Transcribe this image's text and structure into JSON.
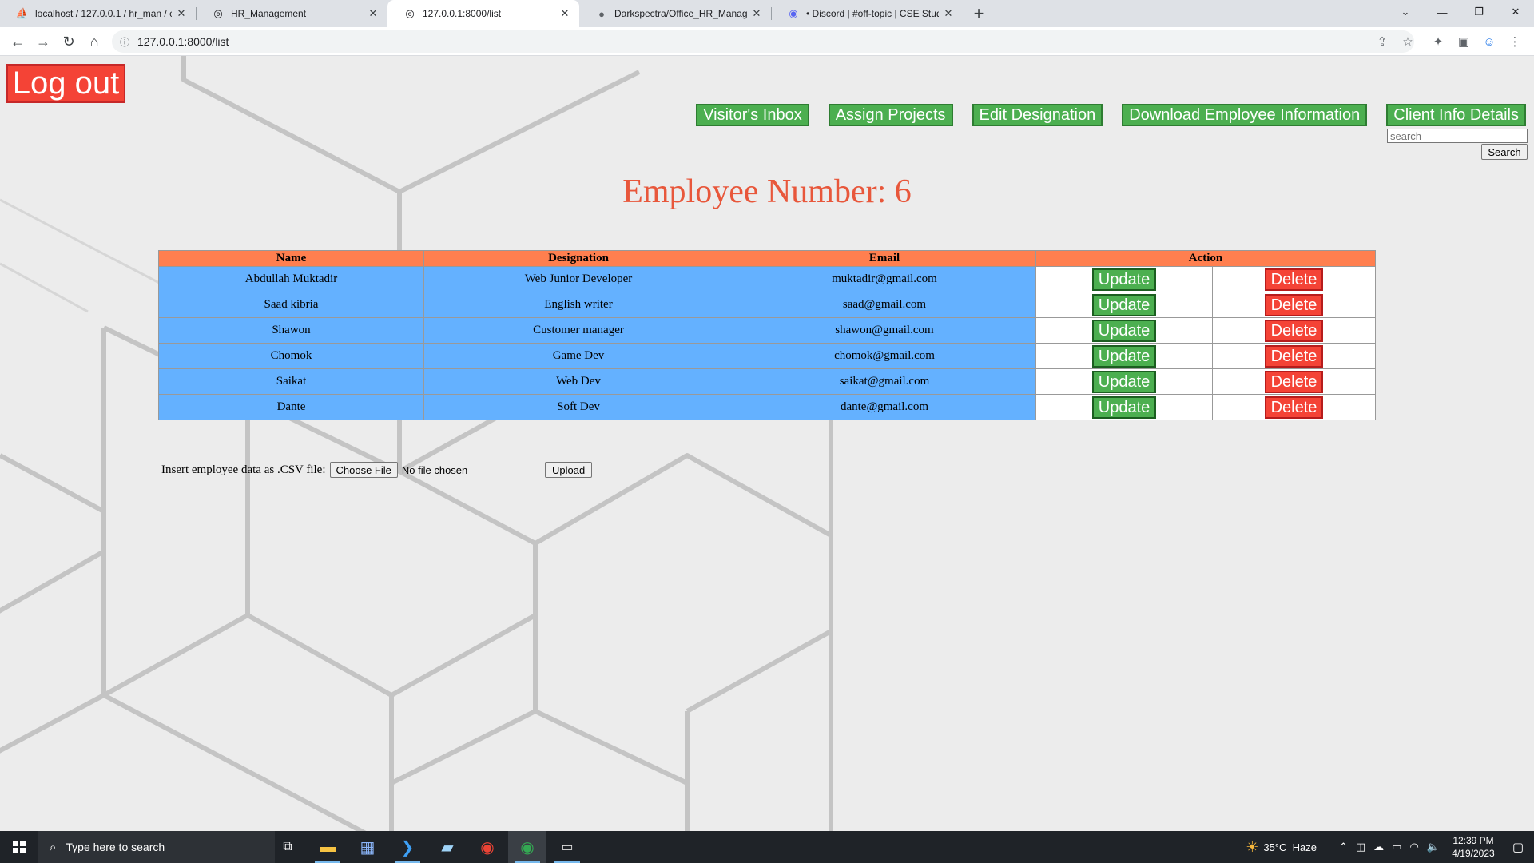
{
  "browser": {
    "tabs": [
      {
        "title": "localhost / 127.0.0.1 / hr_man / e",
        "active": false
      },
      {
        "title": "HR_Management",
        "active": false
      },
      {
        "title": "127.0.0.1:8000/list",
        "active": true
      },
      {
        "title": "Darkspectra/Office_HR_Managem",
        "active": false
      },
      {
        "title": "• Discord | #off-topic | CSE Stude",
        "active": false
      }
    ],
    "url": "127.0.0.1:8000/list"
  },
  "page": {
    "logout_label": "Log out",
    "nav": [
      "Visitor's Inbox",
      "Assign Projects",
      "Edit Designation",
      "Download Employee Information",
      "Client Info Details"
    ],
    "search_placeholder": "search",
    "search_button": "Search",
    "heading": "Employee Number: 6",
    "table": {
      "headers": [
        "Name",
        "Designation",
        "Email",
        "Action"
      ],
      "rows": [
        {
          "name": "Abdullah Muktadir",
          "designation": "Web Junior Developer",
          "email": "muktadir@gmail.com"
        },
        {
          "name": "Saad kibria",
          "designation": "English writer",
          "email": "saad@gmail.com"
        },
        {
          "name": "Shawon",
          "designation": "Customer manager",
          "email": "shawon@gmail.com"
        },
        {
          "name": "Chomok",
          "designation": "Game Dev",
          "email": "chomok@gmail.com"
        },
        {
          "name": "Saikat",
          "designation": "Web Dev",
          "email": "saikat@gmail.com"
        },
        {
          "name": "Dante",
          "designation": "Soft Dev",
          "email": "dante@gmail.com"
        }
      ],
      "update_label": "Update",
      "delete_label": "Delete"
    },
    "csv": {
      "label": "Insert employee data as .CSV file:",
      "choose_label": "Choose File",
      "no_file": "No file chosen",
      "upload_label": "Upload"
    }
  },
  "taskbar": {
    "search_placeholder": "Type here to search",
    "weather": "35°C  Haze",
    "time": "12:39 PM",
    "date": "4/19/2023"
  },
  "colors": {
    "logout": "#f44336",
    "nav_button": "#4caf50",
    "heading": "#e8573b",
    "table_header": "#ff7f4f",
    "table_cell": "#64b1ff"
  }
}
